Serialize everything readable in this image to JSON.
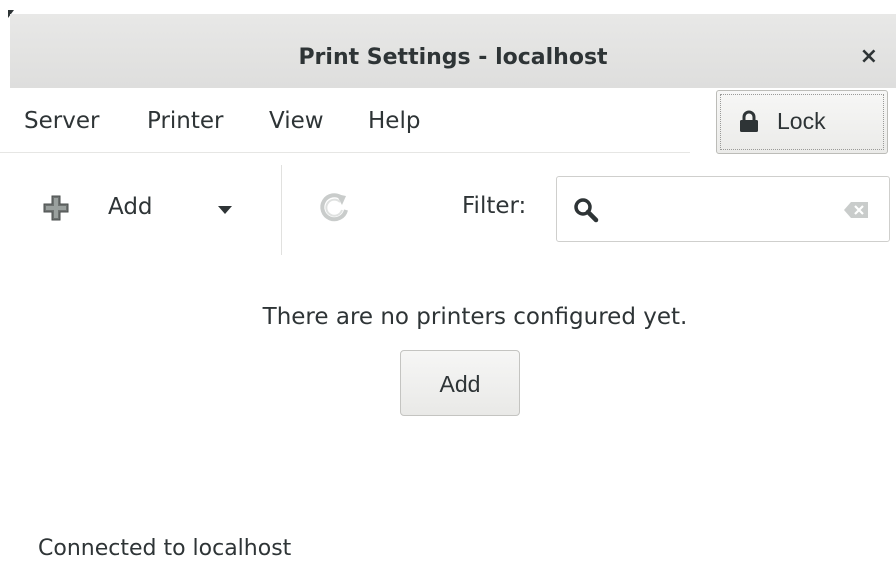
{
  "window": {
    "title": "Print Settings - localhost",
    "close_glyph": "×"
  },
  "menubar": {
    "items": [
      "Server",
      "Printer",
      "View",
      "Help"
    ],
    "lock_label": "Lock"
  },
  "toolbar": {
    "add_label": "Add",
    "filter_label": "Filter:",
    "filter_value": "",
    "filter_placeholder": ""
  },
  "main": {
    "empty_message": "There are no printers configured yet.",
    "add_button_label": "Add"
  },
  "statusbar": {
    "text": "Connected to localhost"
  },
  "icons": {
    "lock": "lock-icon",
    "add": "plus-icon",
    "dropdown": "chevron-down-icon",
    "refresh": "refresh-icon",
    "search": "search-icon",
    "clear": "clear-icon",
    "close": "close-icon"
  },
  "colors": {
    "titlebar_bg": "#e4e4e3",
    "text": "#2e3436",
    "border": "#c4c4c1"
  }
}
